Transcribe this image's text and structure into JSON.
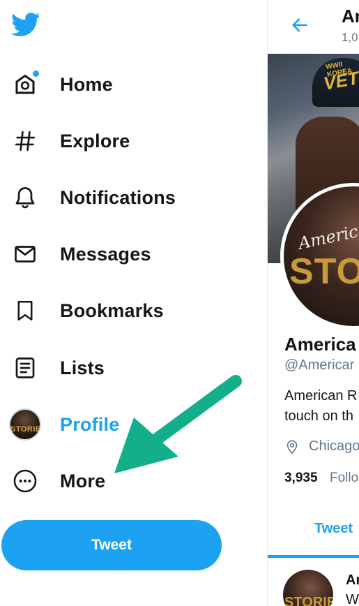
{
  "sidebar": {
    "logo_icon": "twitter-bird-icon",
    "items": [
      {
        "label": "Home",
        "icon": "home-icon",
        "has_dot": true
      },
      {
        "label": "Explore",
        "icon": "hashtag-icon"
      },
      {
        "label": "Notifications",
        "icon": "bell-icon"
      },
      {
        "label": "Messages",
        "icon": "envelope-icon"
      },
      {
        "label": "Bookmarks",
        "icon": "bookmark-icon"
      },
      {
        "label": "Lists",
        "icon": "list-icon"
      },
      {
        "label": "Profile",
        "icon": "profile-avatar",
        "active": true,
        "avatar_text": "STORIES"
      },
      {
        "label": "More",
        "icon": "more-icon"
      }
    ],
    "tweet_button_label": "Tweet"
  },
  "profile_header": {
    "back_icon": "back-arrow-icon",
    "name": "Ar",
    "count": "1,0"
  },
  "profile": {
    "banner_hat_small": "WWII KOREA",
    "banner_hat_text": "VETE",
    "avatar_script": "American",
    "avatar_stories": "STOR",
    "name": "America",
    "handle": "@Americar",
    "bio_line1": "American R",
    "bio_line2": "touch on th",
    "location_icon": "location-pin-icon",
    "location": "Chicago",
    "followers_count": "3,935",
    "followers_label": "Follo",
    "tab_label": "Tweet"
  },
  "feed": {
    "first_name": "Ar",
    "first_text": "W",
    "avatar_text": "STORIES"
  },
  "annotation": {
    "arrow_color": "#13ae8a",
    "accent": "#1da1f2"
  }
}
